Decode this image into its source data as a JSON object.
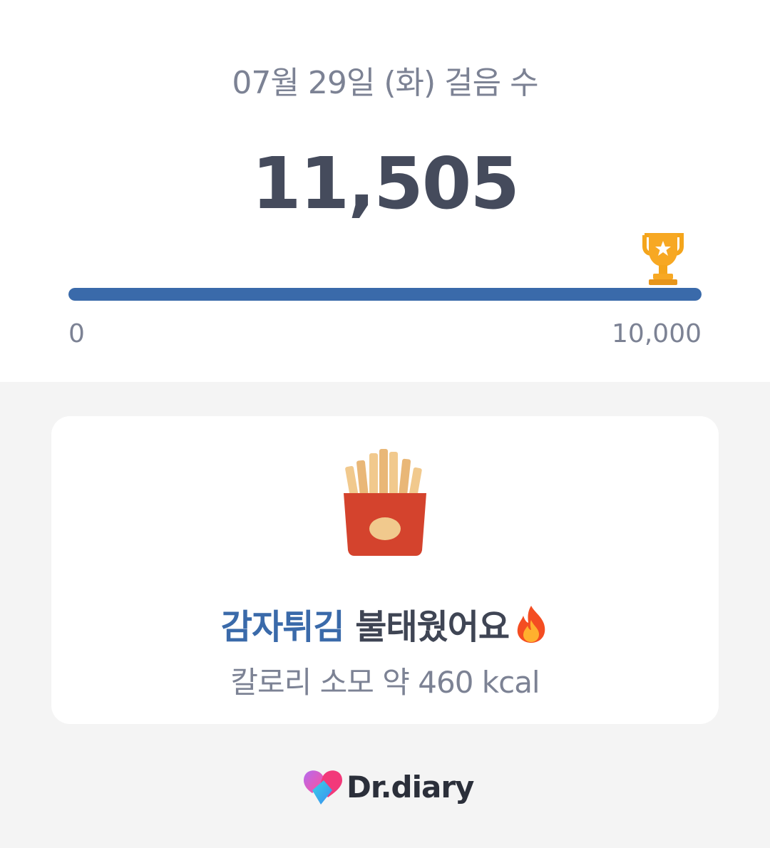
{
  "header": {
    "date_title": "07월 29일 (화) 걸음 수",
    "step_count": "11,505"
  },
  "progress": {
    "min_label": "0",
    "max_label": "10,000",
    "value": 11505,
    "goal": 10000,
    "fill_fraction": 1.0,
    "fill_color": "#3a6aaa",
    "track_color": "#e3e6ec",
    "goal_icon": "trophy-icon"
  },
  "burn_card": {
    "food_icon": "french-fries-icon",
    "food_name": "감자튀김",
    "burned_text": "불태웠어요",
    "fire_icon": "fire-icon",
    "calorie_text": "칼로리 소모 약 460 kcal"
  },
  "brand": {
    "logo_icon": "heart-logo-icon",
    "name": "Dr.diary"
  },
  "colors": {
    "accent": "#3a6aaa",
    "text_primary": "#454b5c",
    "text_secondary": "#7c8294",
    "background": "#f4f4f4"
  }
}
